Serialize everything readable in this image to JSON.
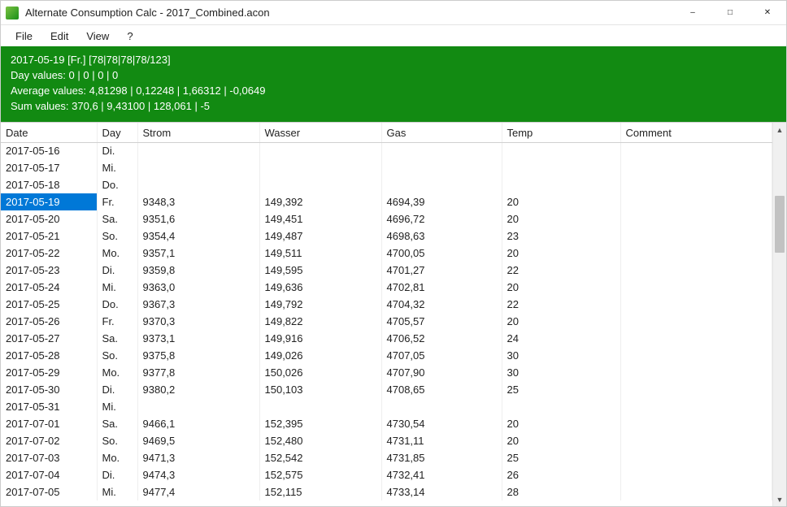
{
  "window": {
    "title": "Alternate Consumption Calc - 2017_Combined.acon"
  },
  "menu": {
    "file": "File",
    "edit": "Edit",
    "view": "View",
    "help": "?"
  },
  "info": {
    "line1": "2017-05-19 [Fr.] [78|78|78|78/123]",
    "line2": "Day values: 0 | 0 | 0 | 0",
    "line3": "Average values: 4,81298 | 0,12248 | 1,66312 | -0,0649",
    "line4": "Sum values: 370,6 | 9,43100 | 128,061 | -5"
  },
  "columns": {
    "date": "Date",
    "day": "Day",
    "strom": "Strom",
    "wasser": "Wasser",
    "gas": "Gas",
    "temp": "Temp",
    "comment": "Comment"
  },
  "rows": [
    {
      "date": "2017-05-16",
      "day": "Di.",
      "strom": "",
      "wasser": "",
      "gas": "",
      "temp": "",
      "comment": "",
      "selected": false
    },
    {
      "date": "2017-05-17",
      "day": "Mi.",
      "strom": "",
      "wasser": "",
      "gas": "",
      "temp": "",
      "comment": "",
      "selected": false
    },
    {
      "date": "2017-05-18",
      "day": "Do.",
      "strom": "",
      "wasser": "",
      "gas": "",
      "temp": "",
      "comment": "",
      "selected": false
    },
    {
      "date": "2017-05-19",
      "day": "Fr.",
      "strom": "9348,3",
      "wasser": "149,392",
      "gas": "4694,39",
      "temp": "20",
      "comment": "",
      "selected": true
    },
    {
      "date": "2017-05-20",
      "day": "Sa.",
      "strom": "9351,6",
      "wasser": "149,451",
      "gas": "4696,72",
      "temp": "20",
      "comment": "",
      "selected": false
    },
    {
      "date": "2017-05-21",
      "day": "So.",
      "strom": "9354,4",
      "wasser": "149,487",
      "gas": "4698,63",
      "temp": "23",
      "comment": "",
      "selected": false
    },
    {
      "date": "2017-05-22",
      "day": "Mo.",
      "strom": "9357,1",
      "wasser": "149,511",
      "gas": "4700,05",
      "temp": "20",
      "comment": "",
      "selected": false
    },
    {
      "date": "2017-05-23",
      "day": "Di.",
      "strom": "9359,8",
      "wasser": "149,595",
      "gas": "4701,27",
      "temp": "22",
      "comment": "",
      "selected": false
    },
    {
      "date": "2017-05-24",
      "day": "Mi.",
      "strom": "9363,0",
      "wasser": "149,636",
      "gas": "4702,81",
      "temp": "20",
      "comment": "",
      "selected": false
    },
    {
      "date": "2017-05-25",
      "day": "Do.",
      "strom": "9367,3",
      "wasser": "149,792",
      "gas": "4704,32",
      "temp": "22",
      "comment": "",
      "selected": false
    },
    {
      "date": "2017-05-26",
      "day": "Fr.",
      "strom": "9370,3",
      "wasser": "149,822",
      "gas": "4705,57",
      "temp": "20",
      "comment": "",
      "selected": false
    },
    {
      "date": "2017-05-27",
      "day": "Sa.",
      "strom": "9373,1",
      "wasser": "149,916",
      "gas": "4706,52",
      "temp": "24",
      "comment": "",
      "selected": false
    },
    {
      "date": "2017-05-28",
      "day": "So.",
      "strom": "9375,8",
      "wasser": "149,026",
      "gas": "4707,05",
      "temp": "30",
      "comment": "",
      "selected": false
    },
    {
      "date": "2017-05-29",
      "day": "Mo.",
      "strom": "9377,8",
      "wasser": "150,026",
      "gas": "4707,90",
      "temp": "30",
      "comment": "",
      "selected": false
    },
    {
      "date": "2017-05-30",
      "day": "Di.",
      "strom": "9380,2",
      "wasser": "150,103",
      "gas": "4708,65",
      "temp": "25",
      "comment": "",
      "selected": false
    },
    {
      "date": "2017-05-31",
      "day": "Mi.",
      "strom": "",
      "wasser": "",
      "gas": "",
      "temp": "",
      "comment": "",
      "selected": false
    },
    {
      "date": "2017-07-01",
      "day": "Sa.",
      "strom": "9466,1",
      "wasser": "152,395",
      "gas": "4730,54",
      "temp": "20",
      "comment": "",
      "selected": false
    },
    {
      "date": "2017-07-02",
      "day": "So.",
      "strom": "9469,5",
      "wasser": "152,480",
      "gas": "4731,11",
      "temp": "20",
      "comment": "",
      "selected": false
    },
    {
      "date": "2017-07-03",
      "day": "Mo.",
      "strom": "9471,3",
      "wasser": "152,542",
      "gas": "4731,85",
      "temp": "25",
      "comment": "",
      "selected": false
    },
    {
      "date": "2017-07-04",
      "day": "Di.",
      "strom": "9474,3",
      "wasser": "152,575",
      "gas": "4732,41",
      "temp": "26",
      "comment": "",
      "selected": false
    },
    {
      "date": "2017-07-05",
      "day": "Mi.",
      "strom": "9477,4",
      "wasser": "152,115",
      "gas": "4733,14",
      "temp": "28",
      "comment": "",
      "selected": false
    }
  ]
}
